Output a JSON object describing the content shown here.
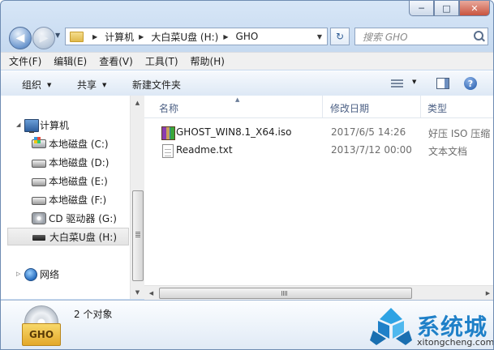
{
  "window": {
    "caption_buttons": {
      "minimize": "─",
      "maximize": "□",
      "close": "✕"
    }
  },
  "address_bar": {
    "crumbs": [
      "计算机",
      "大白菜U盘 (H:)",
      "GHO"
    ]
  },
  "search": {
    "placeholder": "搜索 GHO"
  },
  "menu": [
    "文件(F)",
    "编辑(E)",
    "查看(V)",
    "工具(T)",
    "帮助(H)"
  ],
  "command_bar": {
    "organize": "组织",
    "share": "共享",
    "new_folder": "新建文件夹",
    "help": "?"
  },
  "nav_pane": {
    "computer": "计算机",
    "drives": [
      {
        "label": "本地磁盘 (C:)",
        "icon": "system-drive-icon"
      },
      {
        "label": "本地磁盘 (D:)",
        "icon": "drive-icon"
      },
      {
        "label": "本地磁盘 (E:)",
        "icon": "drive-icon"
      },
      {
        "label": "本地磁盘 (F:)",
        "icon": "drive-icon"
      },
      {
        "label": "CD 驱动器 (G:)",
        "icon": "cd-drive-icon"
      },
      {
        "label": "大白菜U盘 (H:)",
        "icon": "usb-drive-icon",
        "selected": true
      }
    ],
    "network": "网络"
  },
  "columns": {
    "name": "名称",
    "modified": "修改日期",
    "type": "类型"
  },
  "files": [
    {
      "name": "GHOST_WIN8.1_X64.iso",
      "modified": "2017/6/5 14:26",
      "type": "好压 ISO 压缩",
      "icon": "archive-icon"
    },
    {
      "name": "Readme.txt",
      "modified": "2013/7/12 00:00",
      "type": "文本文档",
      "icon": "text-file-icon"
    }
  ],
  "details": {
    "icon_label": "GHO",
    "object_count": "2 个对象"
  },
  "watermark": {
    "cn": "系统城",
    "url": "xitongcheng.com"
  },
  "colors": {
    "watermark_blue": "#1f80c8",
    "column_header": "#4d6185"
  }
}
